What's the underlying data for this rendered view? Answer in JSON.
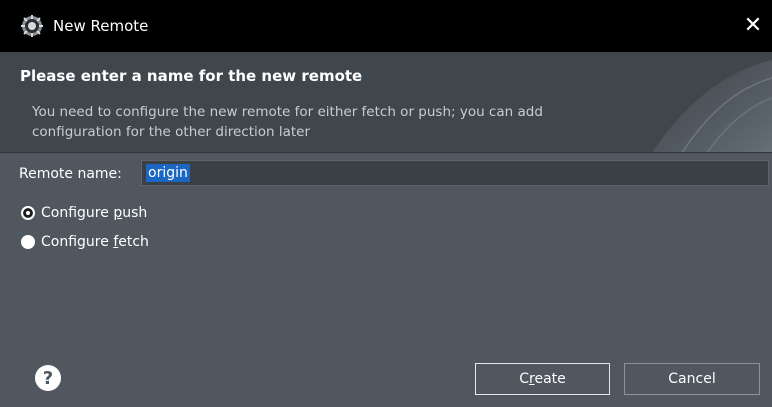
{
  "window": {
    "title": "New Remote",
    "close_glyph": "✕",
    "icon": "eclipse-icon"
  },
  "banner": {
    "title": "Please enter a name for the new remote",
    "description_line1": "You need to configure the new remote for either fetch or push; you can add",
    "description_line2": "configuration for the other direction later"
  },
  "form": {
    "remote_name_label": "Remote name:",
    "remote_name_value": "origin",
    "options": [
      {
        "pre": "Configure ",
        "mnemonic": "p",
        "post": "ush",
        "selected": true
      },
      {
        "pre": "Configure ",
        "mnemonic": "f",
        "post": "etch",
        "selected": false
      }
    ]
  },
  "footer": {
    "help_glyph": "?",
    "create_pre": "C",
    "create_mnemonic": "r",
    "create_post": "eate",
    "cancel_label": "Cancel"
  }
}
